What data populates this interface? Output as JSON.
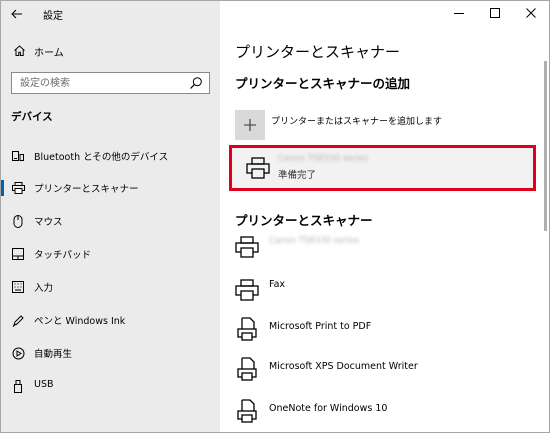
{
  "window": {
    "title": "設定",
    "controls": {
      "minimize": "minimize-icon",
      "maximize": "maximize-icon",
      "close": "close-icon"
    }
  },
  "sidebar": {
    "home_label": "ホーム",
    "search_placeholder": "設定の検索",
    "section_title": "デバイス",
    "items": [
      {
        "label": "Bluetooth とその他のデバイス",
        "icon": "bluetooth-devices-icon",
        "selected": false
      },
      {
        "label": "プリンターとスキャナー",
        "icon": "printer-icon",
        "selected": true
      },
      {
        "label": "マウス",
        "icon": "mouse-icon",
        "selected": false
      },
      {
        "label": "タッチパッド",
        "icon": "touchpad-icon",
        "selected": false
      },
      {
        "label": "入力",
        "icon": "keyboard-icon",
        "selected": false
      },
      {
        "label": "ペンと Windows Ink",
        "icon": "pen-icon",
        "selected": false
      },
      {
        "label": "自動再生",
        "icon": "autoplay-icon",
        "selected": false
      },
      {
        "label": "USB",
        "icon": "usb-icon",
        "selected": false
      }
    ]
  },
  "main": {
    "page_title": "プリンターとスキャナー",
    "add_section_heading": "プリンターとスキャナーの追加",
    "add_button_label": "プリンターまたはスキャナーを追加します",
    "highlighted_printer": {
      "name": "Canon TS8330 series",
      "status": "準備完了"
    },
    "list_heading": "プリンターとスキャナー",
    "devices": [
      {
        "label": "Canon TS8330 series",
        "blurred": true,
        "icon": "printer-icon"
      },
      {
        "label": "Fax",
        "blurred": false,
        "icon": "printer-icon"
      },
      {
        "label": "Microsoft Print to PDF",
        "blurred": false,
        "icon": "document-printer-icon"
      },
      {
        "label": "Microsoft XPS Document Writer",
        "blurred": false,
        "icon": "document-printer-icon"
      },
      {
        "label": "OneNote for Windows 10",
        "blurred": false,
        "icon": "document-printer-icon"
      }
    ]
  },
  "colors": {
    "accent": "#0063b1",
    "highlight_border": "#e0001b",
    "sidebar_bg": "#ebebeb"
  }
}
